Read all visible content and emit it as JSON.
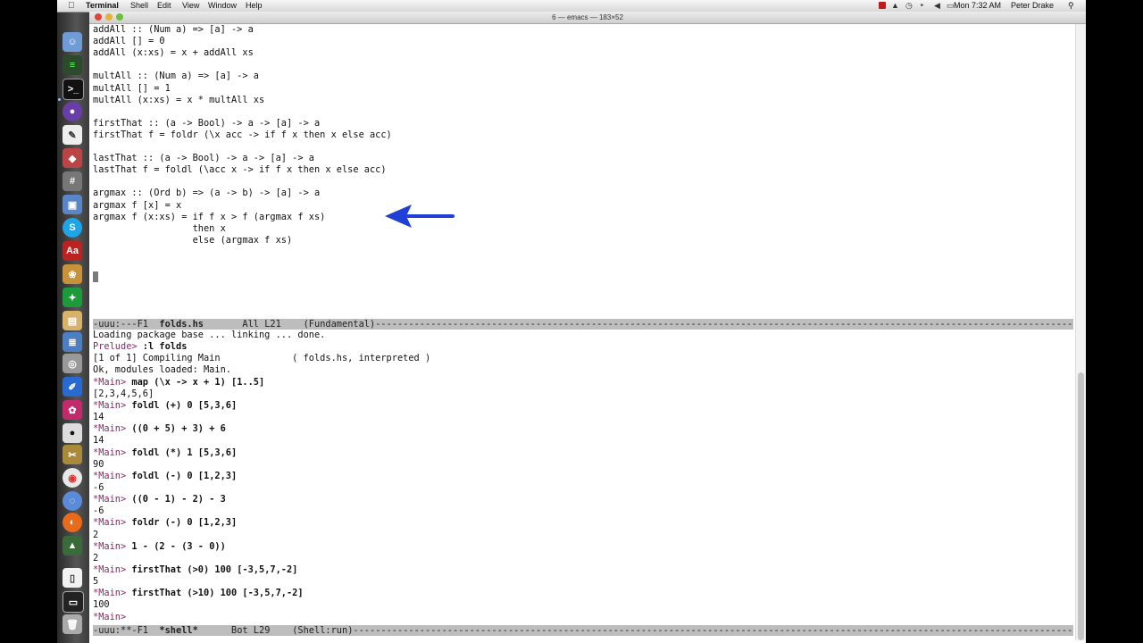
{
  "menubar": {
    "app": "Terminal",
    "items": [
      "Shell",
      "Edit",
      "View",
      "Window",
      "Help"
    ],
    "clock": "Mon 7:32 AM",
    "user": "Peter Drake"
  },
  "window": {
    "title": "6 — emacs — 183×52"
  },
  "editor": {
    "lines": [
      "addAll :: (Num a) => [a] -> a",
      "addAll [] = 0",
      "addAll (x:xs) = x + addAll xs",
      "",
      "multAll :: (Num a) => [a] -> a",
      "multAll [] = 1",
      "multAll (x:xs) = x * multAll xs",
      "",
      "firstThat :: (a -> Bool) -> a -> [a] -> a",
      "firstThat f = foldr (\\x acc -> if f x then x else acc)",
      "",
      "lastThat :: (a -> Bool) -> a -> [a] -> a",
      "lastThat f = foldl (\\acc x -> if f x then x else acc)",
      "",
      "argmax :: (Ord b) => (a -> b) -> [a] -> a",
      "argmax f [x] = x",
      "argmax f (x:xs) = if f x > f (argmax f xs)",
      "                  then x",
      "                  else (argmax f xs)"
    ],
    "modeline": {
      "prefix": "-uuu:---F1  ",
      "buffer": "folds.hs",
      "rest": "       All L21    (Fundamental)"
    }
  },
  "shell": {
    "lines": [
      {
        "prompt": "",
        "text": "Loading package base ... linking ... done."
      },
      {
        "prompt": "Prelude> ",
        "text": ":l folds",
        "bold": true
      },
      {
        "prompt": "",
        "text": "[1 of 1] Compiling Main             ( folds.hs, interpreted )"
      },
      {
        "prompt": "",
        "text": "Ok, modules loaded: Main."
      },
      {
        "prompt": "*Main> ",
        "text": "map (\\x -> x + 1) [1..5]",
        "bold": true
      },
      {
        "prompt": "",
        "text": "[2,3,4,5,6]"
      },
      {
        "prompt": "*Main> ",
        "text": "foldl (+) 0 [5,3,6]",
        "bold": true
      },
      {
        "prompt": "",
        "text": "14"
      },
      {
        "prompt": "*Main> ",
        "text": "((0 + 5) + 3) + 6",
        "bold": true
      },
      {
        "prompt": "",
        "text": "14"
      },
      {
        "prompt": "*Main> ",
        "text": "foldl (*) 1 [5,3,6]",
        "bold": true
      },
      {
        "prompt": "",
        "text": "90"
      },
      {
        "prompt": "*Main> ",
        "text": "foldl (-) 0 [1,2,3]",
        "bold": true
      },
      {
        "prompt": "",
        "text": "-6"
      },
      {
        "prompt": "*Main> ",
        "text": "((0 - 1) - 2) - 3",
        "bold": true
      },
      {
        "prompt": "",
        "text": "-6"
      },
      {
        "prompt": "*Main> ",
        "text": "foldr (-) 0 [1,2,3]",
        "bold": true
      },
      {
        "prompt": "",
        "text": "2"
      },
      {
        "prompt": "*Main> ",
        "text": "1 - (2 - (3 - 0))",
        "bold": true
      },
      {
        "prompt": "",
        "text": "2"
      },
      {
        "prompt": "*Main> ",
        "text": "firstThat (>0) 100 [-3,5,7,-2]",
        "bold": true
      },
      {
        "prompt": "",
        "text": "5"
      },
      {
        "prompt": "*Main> ",
        "text": "firstThat (>10) 100 [-3,5,7,-2]",
        "bold": true
      },
      {
        "prompt": "",
        "text": "100"
      },
      {
        "prompt": "*Main> ",
        "text": ""
      }
    ],
    "modeline": {
      "prefix": "-uuu:**-F1  ",
      "buffer": "*shell*",
      "rest": "      Bot L29    (Shell:run)"
    }
  },
  "colors": {
    "arrow": "#1f3fd6",
    "prompt": "#8a2a6a",
    "modeline": "#bdbdbd"
  },
  "dock_icons": [
    "finder-icon",
    "activity-icon",
    "terminal-icon",
    "eclipse-icon",
    "textedit-icon",
    "app-icon",
    "calculator-icon",
    "preview-icon",
    "skype-icon",
    "dictionary-icon",
    "photos-icon",
    "greenfoot-icon",
    "notes-icon",
    "stack-icon",
    "dvd-icon",
    "paint-icon",
    "app-icon",
    "go-icon",
    "tools-icon",
    "chrome-icon",
    "network-icon",
    "firefox-icon",
    "app-icon",
    "document-icon",
    "display-icon",
    "trash-icon"
  ]
}
